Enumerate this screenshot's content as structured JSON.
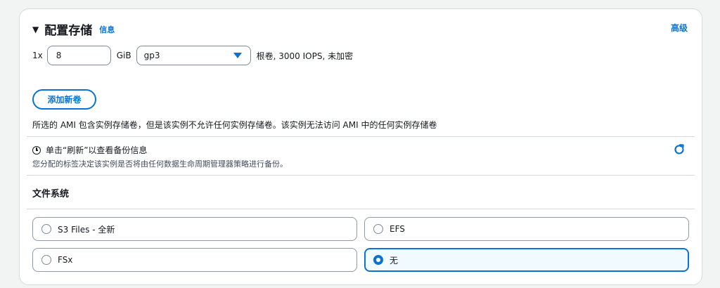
{
  "header": {
    "title": "配置存储",
    "info_link": "信息",
    "advanced_link": "高级"
  },
  "volume": {
    "multiplier": "1x",
    "size_value": "8",
    "unit": "GiB",
    "type_selected": "gp3",
    "description": "根卷, 3000 IOPS, 未加密"
  },
  "add_volume_button": "添加新卷",
  "ami_note": "所选的 AMI 包含实例存储卷，但是该实例不允许任何实例存储卷。该实例无法访问 AMI 中的任何实例存储卷",
  "backup": {
    "title": "单击“刷新”以查看备份信息",
    "subtitle": "您分配的标签决定该实例是否将由任何数据生命周期管理器策略进行备份。"
  },
  "file_systems": {
    "title": "文件系统",
    "options": [
      {
        "label": "S3 Files - 全新",
        "selected": false
      },
      {
        "label": "EFS",
        "selected": false
      },
      {
        "label": "FSx",
        "selected": false
      },
      {
        "label": "无",
        "selected": true
      }
    ]
  },
  "colors": {
    "accent": "#0972d3",
    "selected_bg": "#f1faff",
    "border": "#d5dbdb"
  }
}
